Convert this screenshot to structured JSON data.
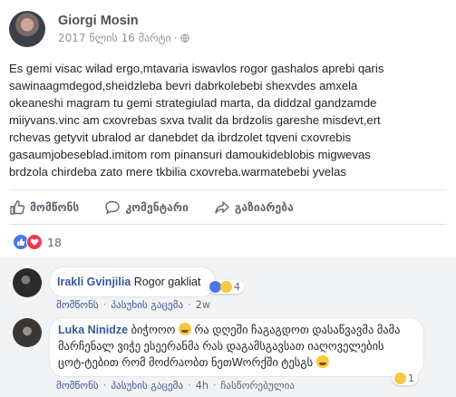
{
  "post": {
    "author": "Giorgi Mosin",
    "date": "2017 წლის 16 მარტი",
    "privacy_icon": "globe-icon",
    "text_lines": [
      "Es gemi visac wilad ergo,mtavaria iswavlos rogor gashalos aprebi qaris",
      "sawinaagmdegod,sheidzleba bevri dabrkolebebi shexvdes amxela",
      "okeaneshi magram tu gemi strategiulad marta, da diddzal gandzamde",
      "miiyvans.vinc am cxovrebas sxva tvalit da brdzolis gareshe misdevt,ert",
      "rchevas getyvit ubralod ar danebdet da ibrdzolet tqveni cxovrebis",
      "gasaumjobeseblad.imitom rom pinansuri damoukideblobis migwevas",
      "brdzola chirdeba zato mere tkbilia cxovreba.warmatebebi yvelas"
    ]
  },
  "actions": {
    "like": "მომწონს",
    "comment": "კომენტარი",
    "share": "გაზიარება"
  },
  "reactions": {
    "count": "18",
    "types": [
      "like",
      "love"
    ],
    "colors": {
      "like": "#4a76e8",
      "love": "#f0384f"
    }
  },
  "comments": [
    {
      "author": "Irakli Gvinjilia",
      "text": "Rogor gakliat",
      "reaction_count": "4",
      "like": "მომწონს",
      "reply": "პასუხის გაცემა",
      "time": "2w"
    },
    {
      "author": "Luka Ninidze",
      "lines": [
        "ბიჭოოო",
        "რა დღეში ჩაგაგდოთ დასაწვავმა მამა",
        "მარჩენალ ვიჭე ესეერანმა რას დაგამსგავსათ იაღოველების",
        "ცოტ-ტებით რომ მოძრაობთ ნეთWორქში ტესგს"
      ],
      "reaction_count": "1",
      "like": "მომწონს",
      "reply": "პასუხის გაცემა",
      "time": "4h",
      "edited": "ჩასწორებულია"
    }
  ],
  "colors": {
    "link": "#385898",
    "text": "#1d2129",
    "muted": "#606770"
  }
}
